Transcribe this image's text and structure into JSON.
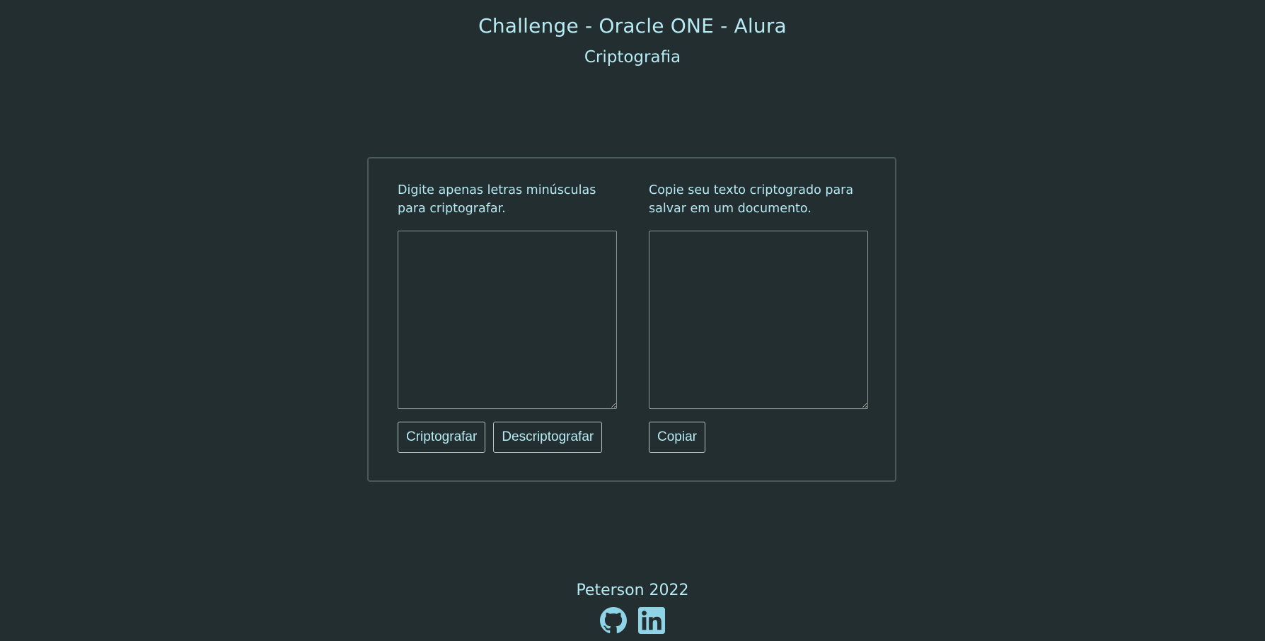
{
  "header": {
    "title": "Challenge - Oracle ONE - Alura",
    "subtitle": "Criptografia"
  },
  "encrypt_panel": {
    "instruction": "Digite apenas letras minúsculas para criptografar.",
    "input_value": "",
    "encrypt_label": "Criptografar",
    "decrypt_label": "Descriptografar"
  },
  "output_panel": {
    "instruction": "Copie seu texto criptogrado para salvar em um documento.",
    "output_value": "",
    "copy_label": "Copiar"
  },
  "footer": {
    "credit": "Peterson 2022",
    "icons": [
      "github-icon",
      "linkedin-icon"
    ]
  },
  "colors": {
    "background": "#222e2f",
    "text": "#b8eaf4",
    "border": "#4a5a5a"
  }
}
